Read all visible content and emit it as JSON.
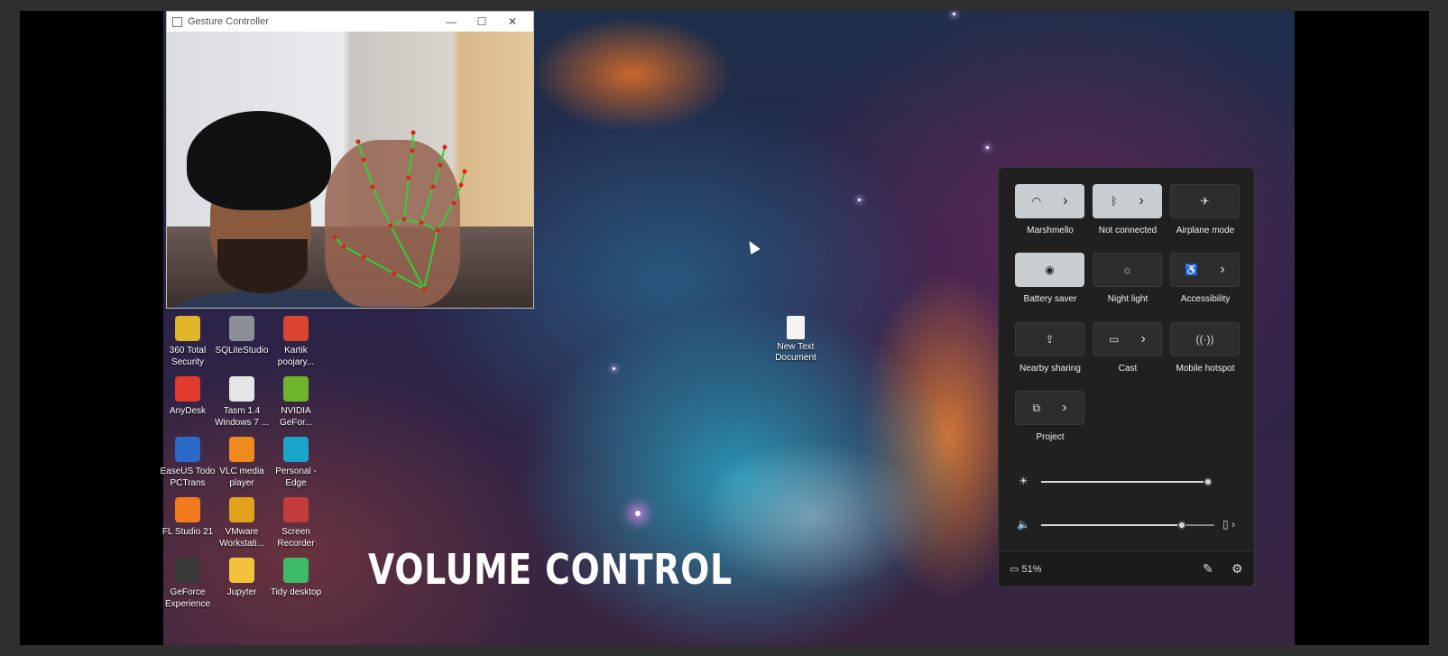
{
  "gesture_window": {
    "title": "Gesture Controller",
    "controls": {
      "minimize": "—",
      "maximize": "☐",
      "close": "✕"
    }
  },
  "desktop_icons": [
    {
      "label_line1": "360 Total",
      "label_line2": "Security",
      "icon": "shield-plus-icon",
      "color": "#e0b52a"
    },
    {
      "label_line1": "SQLiteStudio",
      "label_line2": "",
      "icon": "database-icon",
      "color": "#8a8f98"
    },
    {
      "label_line1": "Kartik",
      "label_line2": "poojary...",
      "icon": "chrome-icon",
      "color": "#d9452f"
    },
    {
      "label_line1": "AnyDesk",
      "label_line2": "",
      "icon": "anydesk-icon",
      "color": "#e23b2e"
    },
    {
      "label_line1": "Tasm 1.4",
      "label_line2": "Windows 7 ...",
      "icon": "apple-icon",
      "color": "#e5e5e5"
    },
    {
      "label_line1": "NVIDIA",
      "label_line2": "GeFor...",
      "icon": "nvidia-icon",
      "color": "#6fb52c"
    },
    {
      "label_line1": "EaseUS Todo",
      "label_line2": "PCTrans",
      "icon": "easeus-icon",
      "color": "#2a69c7"
    },
    {
      "label_line1": "VLC media",
      "label_line2": "player",
      "icon": "vlc-cone-icon",
      "color": "#f08a1c"
    },
    {
      "label_line1": "Personal -",
      "label_line2": "Edge",
      "icon": "edge-icon",
      "color": "#1aa5c9"
    },
    {
      "label_line1": "FL Studio 21",
      "label_line2": "",
      "icon": "fl-studio-icon",
      "color": "#f07a1c"
    },
    {
      "label_line1": "VMware",
      "label_line2": "Workstati...",
      "icon": "vmware-icon",
      "color": "#e0a21a"
    },
    {
      "label_line1": "Screen",
      "label_line2": "Recorder",
      "icon": "screen-recorder-icon",
      "color": "#c43b3b"
    },
    {
      "label_line1": "GeForce",
      "label_line2": "Experience",
      "icon": "geforce-icon",
      "color": "#3a3a3a"
    },
    {
      "label_line1": "Jupyter",
      "label_line2": "",
      "icon": "folder-icon",
      "color": "#f2c23a"
    },
    {
      "label_line1": "Tidy desktop",
      "label_line2": "",
      "icon": "tidy-desktop-icon",
      "color": "#3dba6a"
    }
  ],
  "new_doc": {
    "line1": "New Text",
    "line2": "Document"
  },
  "caption": "VOLUME CONTROL",
  "quick_settings": {
    "tiles": [
      {
        "label": "Marshmello",
        "icon": "wifi-icon",
        "glyph": "◠",
        "chevron": "›",
        "on": true
      },
      {
        "label": "Not connected",
        "icon": "bluetooth-icon",
        "glyph": "ᛒ",
        "chevron": "›",
        "on": true
      },
      {
        "label": "Airplane mode",
        "icon": "airplane-icon",
        "glyph": "✈",
        "chevron": "",
        "on": false
      },
      {
        "label": "Battery saver",
        "icon": "battery-saver-icon",
        "glyph": "◉",
        "chevron": "",
        "on": true
      },
      {
        "label": "Night light",
        "icon": "night-light-icon",
        "glyph": "☼",
        "chevron": "",
        "on": false
      },
      {
        "label": "Accessibility",
        "icon": "accessibility-icon",
        "glyph": "♿",
        "chevron": "›",
        "on": false
      },
      {
        "label": "Nearby sharing",
        "icon": "nearby-sharing-icon",
        "glyph": "⇪",
        "chevron": "",
        "on": false
      },
      {
        "label": "Cast",
        "icon": "cast-icon",
        "glyph": "▭",
        "chevron": "›",
        "on": false
      },
      {
        "label": "Mobile hotspot",
        "icon": "hotspot-icon",
        "glyph": "((·))",
        "chevron": "",
        "on": false
      },
      {
        "label": "Project",
        "icon": "project-icon",
        "glyph": "⧉",
        "chevron": "›",
        "on": false
      }
    ],
    "brightness": {
      "icon": "brightness-icon",
      "glyph": "☀",
      "level": 1.0
    },
    "volume": {
      "icon": "speaker-icon",
      "glyph": "🔈",
      "level": 0.81,
      "device_glyph": "▯",
      "chevron": "›"
    },
    "battery": {
      "glyph": "▭",
      "percent": "51%"
    },
    "edit_glyph": "✎",
    "settings_glyph": "⚙"
  },
  "colors": {
    "tile_on": "#c8cdd1",
    "tile_off": "#2d2d2d",
    "panel": "#202020",
    "landmark_line": "#2fd13a",
    "landmark_dot": "#e0201a"
  }
}
